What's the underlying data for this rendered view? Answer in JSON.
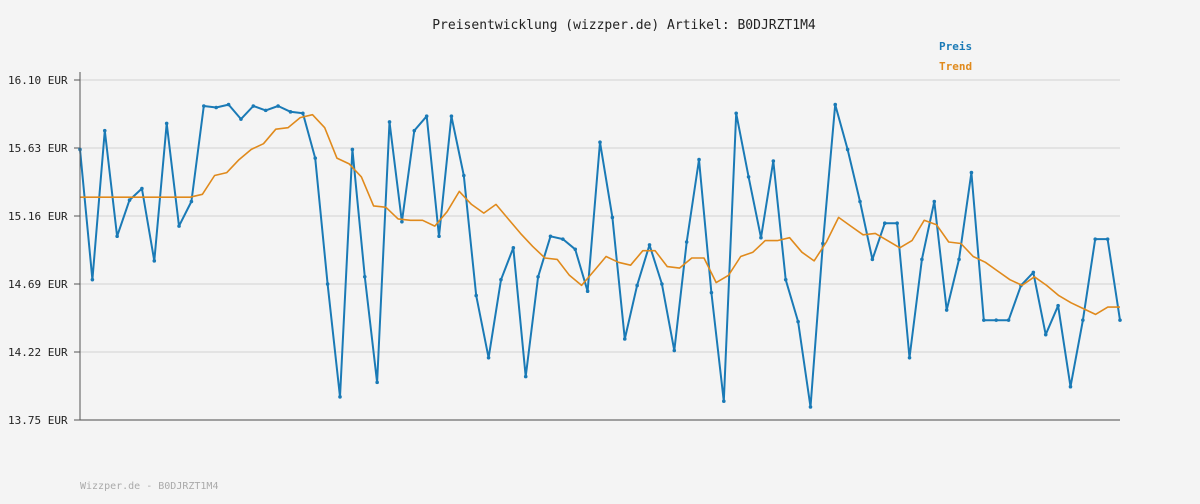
{
  "colors": {
    "preis": "#1a7ab6",
    "trend": "#e08a1c",
    "grid": "#dddddd",
    "axis": "#555555",
    "background": "#f4f4f4"
  },
  "chart_data": {
    "type": "line",
    "title": "Preisentwicklung (wizzper.de) Artikel: B0DJRZT1M4",
    "ylim": [
      13.75,
      16.1
    ],
    "yticks": [
      13.75,
      14.22,
      14.69,
      15.16,
      15.63,
      16.1
    ],
    "ytick_labels": [
      "13.75 EUR",
      "14.22 EUR",
      "14.69 EUR",
      "15.16 EUR",
      "15.63 EUR",
      "16.10 EUR"
    ],
    "xlabel": "",
    "ylabel": "",
    "grid": true,
    "legend_position": "top-right",
    "series": [
      {
        "name": "Preis",
        "color": "#1a7ab6",
        "values": [
          15.62,
          14.72,
          15.75,
          15.02,
          15.27,
          15.35,
          14.85,
          15.8,
          15.09,
          15.26,
          15.92,
          15.91,
          15.93,
          15.83,
          15.92,
          15.89,
          15.92,
          15.88,
          15.87,
          15.56,
          14.69,
          13.91,
          15.62,
          14.74,
          14.01,
          15.81,
          15.12,
          15.75,
          15.85,
          15.02,
          15.85,
          15.44,
          14.61,
          14.18,
          14.72,
          14.94,
          14.05,
          14.74,
          15.02,
          15.0,
          14.93,
          14.64,
          15.67,
          15.15,
          14.31,
          14.68,
          14.96,
          14.69,
          14.23,
          14.98,
          15.55,
          14.63,
          13.88,
          15.87,
          15.43,
          15.01,
          15.54,
          14.72,
          14.43,
          13.84,
          14.97,
          15.93,
          15.62,
          15.26,
          14.86,
          15.11,
          15.11,
          14.18,
          14.86,
          15.26,
          14.51,
          14.86,
          15.46,
          14.44,
          14.44,
          14.44,
          14.68,
          14.77,
          14.34,
          14.54,
          13.98,
          14.44,
          15.0,
          15.0,
          14.44
        ],
        "y_min_observed": 13.84
      },
      {
        "name": "Trend",
        "color": "#e08a1c",
        "values": [
          15.29,
          15.29,
          15.29,
          15.29,
          15.29,
          15.29,
          15.29,
          15.29,
          15.29,
          15.29,
          15.31,
          15.44,
          15.46,
          15.55,
          15.62,
          15.66,
          15.76,
          15.77,
          15.84,
          15.86,
          15.77,
          15.56,
          15.52,
          15.43,
          15.23,
          15.22,
          15.14,
          15.13,
          15.13,
          15.09,
          15.19,
          15.33,
          15.24,
          15.18,
          15.24,
          15.14,
          15.04,
          14.95,
          14.87,
          14.86,
          14.75,
          14.68,
          14.78,
          14.88,
          14.84,
          14.82,
          14.92,
          14.92,
          14.81,
          14.8,
          14.87,
          14.87,
          14.7,
          14.75,
          14.88,
          14.91,
          14.99,
          14.99,
          15.01,
          14.91,
          14.85,
          14.98,
          15.15,
          15.09,
          15.03,
          15.04,
          14.99,
          14.94,
          14.99,
          15.13,
          15.1,
          14.98,
          14.97,
          14.88,
          14.84,
          14.78,
          14.72,
          14.68,
          14.74,
          14.68,
          14.61,
          14.56,
          14.52,
          14.48,
          14.53,
          14.53
        ]
      }
    ]
  },
  "footer": "Wizzper.de - B0DJRZT1M4"
}
